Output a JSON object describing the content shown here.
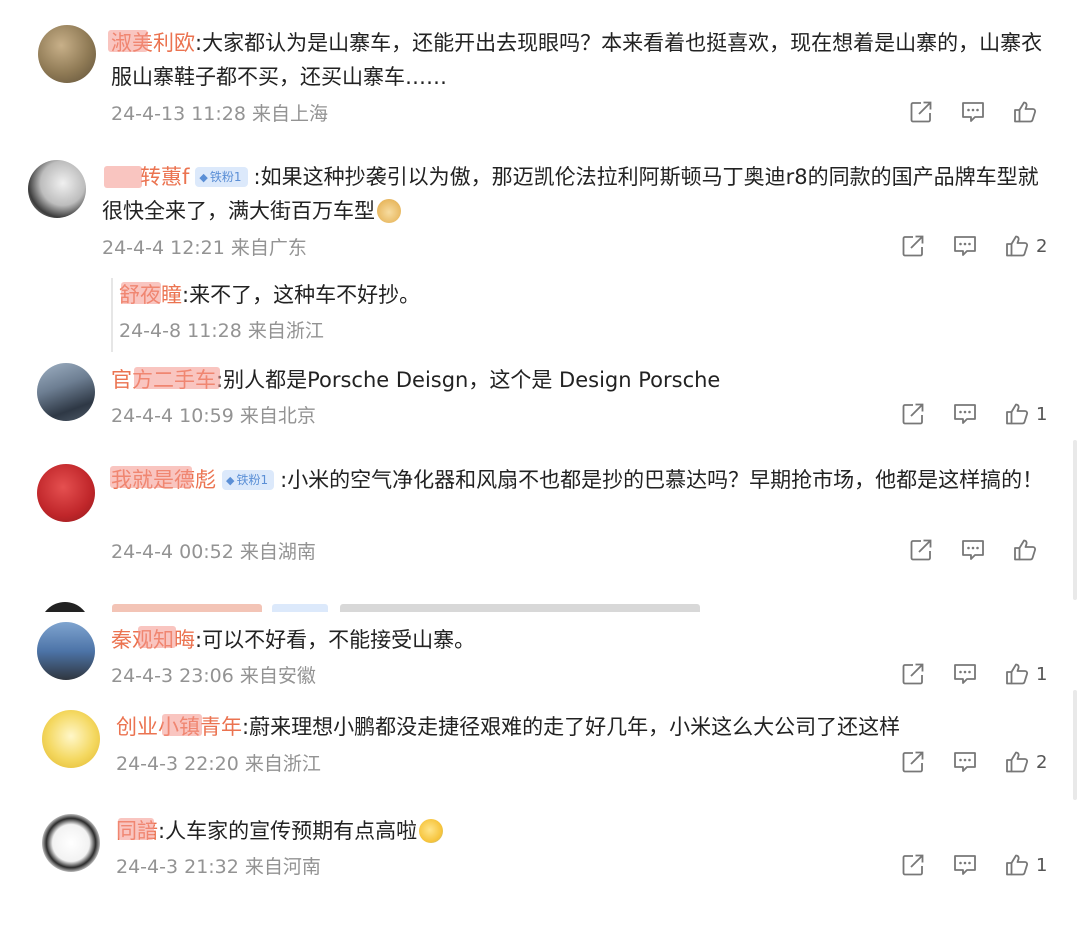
{
  "comments": [
    {
      "username": "淑美利欧",
      "text": "大家都认为是山寨车，还能开出去现眼吗？本来看着也挺喜欢，现在想着是山寨的，山寨衣服山寨鞋子都不买，还买山寨车……",
      "date": "24-4-13 11:28",
      "location": "来自上海",
      "likes": ""
    },
    {
      "username": "转蕙f",
      "badge": "铁粉1",
      "text": "如果这种抄袭引以为傲，那迈凯伦法拉利阿斯顿马丁奥迪r8的同款的国产品牌车型就很快全来了，满大街百万车型",
      "date": "24-4-4 12:21",
      "location": "来自广东",
      "likes": "2"
    },
    {
      "username": "舒夜瞳",
      "text": "来不了，这种车不好抄。",
      "date": "24-4-8 11:28",
      "location": "来自浙江"
    },
    {
      "username": "官方二手车",
      "text": "别人都是Porsche Deisgn，这个是 Design Porsche",
      "date": "24-4-4 10:59",
      "location": "来自北京",
      "likes": "1"
    },
    {
      "username": "我就是德彪",
      "badge": "铁粉1",
      "text": "小米的空气净化器和风扇不也都是抄的巴慕达吗？早期抢市场，他都是这样搞的！",
      "date": "24-4-4 00:52",
      "location": "来自湖南",
      "likes": ""
    },
    {
      "username": "秦观知晦",
      "text": "可以不好看，不能接受山寨。",
      "date": "24-4-3 23:06",
      "location": "来自安徽",
      "likes": "1"
    },
    {
      "username": "创业小镇青年",
      "text": "蔚来理想小鹏都没走捷径艰难的走了好几年，小米这么大公司了还这样",
      "date": "24-4-3 22:20",
      "location": "来自浙江",
      "likes": "2"
    },
    {
      "username": "同諳",
      "text": "人车家的宣传预期有点高啦",
      "date": "24-4-3 21:32",
      "location": "来自河南",
      "likes": "1"
    }
  ],
  "colors": {
    "username": "#eb7350",
    "meta": "#939393",
    "text": "#222222",
    "badge_bg": "#dce9fb",
    "badge_fg": "#5b8fd6"
  },
  "icons": [
    "share-icon",
    "comment-icon",
    "like-icon",
    "doge-emoji-icon",
    "laugh-cry-emoji-icon"
  ]
}
